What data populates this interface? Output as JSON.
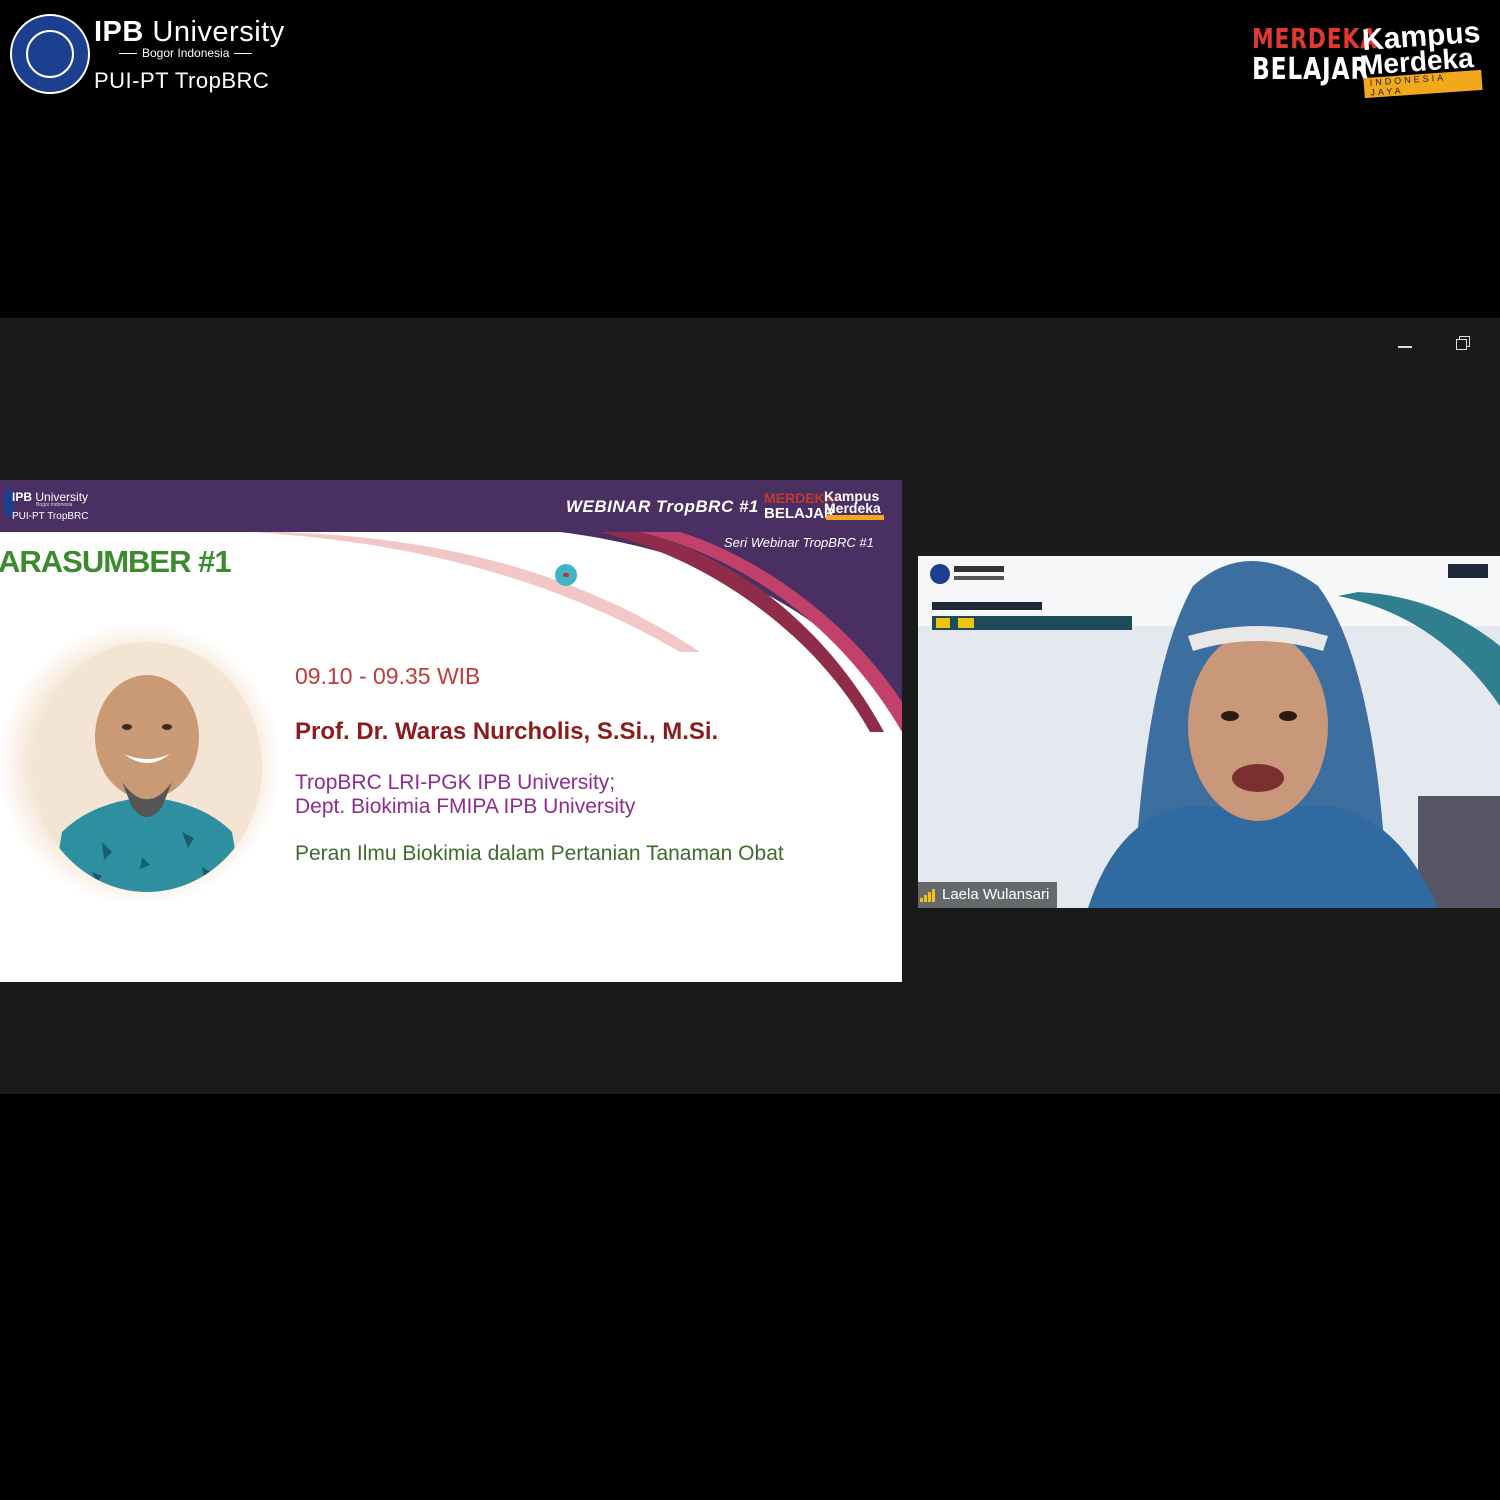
{
  "branding_left": {
    "title_bold": "IPB",
    "title_thin": "University",
    "subtitle": "Bogor Indonesia",
    "unit": "PUI-PT TropBRC"
  },
  "branding_right": {
    "merdeka": "MERDEKA",
    "belajar": "BELAJAR",
    "kampus": "Kampus",
    "merdeka_script": "Merdeka",
    "tagline": "INDONESIA JAYA"
  },
  "window_controls": {
    "minimize_icon": "minimize-icon",
    "restore_icon": "restore-icon"
  },
  "slide": {
    "header": {
      "ipb_bold": "IPB",
      "ipb_thin": "University",
      "bogor": "Bogor Indonesia",
      "unit": "PUI-PT TropBRC",
      "webinar_title": "WEBINAR TropBRC #1",
      "merdeka": "MERDEKA",
      "belajar": "BELAJAR",
      "kampus": "Kampus",
      "merdeka_script": "Merdeka"
    },
    "series": "Seri Webinar TropBRC #1",
    "section_title": "ARASUMBER #1",
    "time": "09.10 - 09.35 WIB",
    "speaker": "Prof. Dr. Waras Nurcholis, S.Si., M.Si.",
    "affiliation_1": "TropBRC LRI-PGK IPB University;",
    "affiliation_2": "Dept. Biokimia FMIPA IPB University",
    "topic": "Peran Ilmu Biokimia dalam Pertanian Tanaman Obat"
  },
  "participant": {
    "name": "Laela Wulansari"
  },
  "colors": {
    "header_purple": "#4a2f63",
    "accent_red": "#c0392b",
    "green": "#3b8a2e"
  }
}
